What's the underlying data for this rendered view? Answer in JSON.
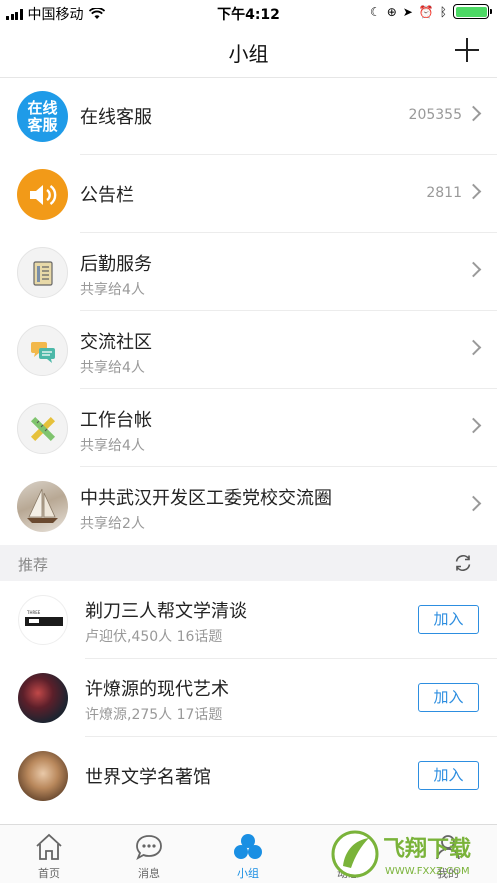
{
  "status": {
    "carrier": "中国移动",
    "time": "下午4:12",
    "battery_level": 1.0
  },
  "nav": {
    "title": "小组"
  },
  "groups": [
    {
      "title": "在线客服",
      "count": "205355",
      "avatar_text": "在线\n客服",
      "icon": "customer-service-icon"
    },
    {
      "title": "公告栏",
      "count": "2811",
      "icon": "speaker-icon"
    },
    {
      "title": "后勤服务",
      "sub": "共享给4人",
      "icon": "document-icon"
    },
    {
      "title": "交流社区",
      "sub": "共享给4人",
      "icon": "chat-bubbles-icon"
    },
    {
      "title": "工作台帐",
      "sub": "共享给4人",
      "icon": "ruler-pencil-icon"
    },
    {
      "title": "中共武汉开发区工委党校交流圈",
      "sub": "共享给2人",
      "icon": "sailboat-photo"
    }
  ],
  "section": {
    "label": "推荐"
  },
  "recommend": [
    {
      "title": "剃刀三人帮文学清谈",
      "sub": "卢迎伏,450人 16话题",
      "join": "加入"
    },
    {
      "title": "许燎源的现代艺术",
      "sub": "许燎源,275人 17话题",
      "join": "加入"
    },
    {
      "title": "世界文学名著馆",
      "join": "加入"
    }
  ],
  "tabs": [
    {
      "label": "首页",
      "icon": "home-icon"
    },
    {
      "label": "消息",
      "icon": "message-icon"
    },
    {
      "label": "小组",
      "icon": "group-icon",
      "active": true
    },
    {
      "label": "动态",
      "icon": "activity-icon"
    },
    {
      "label": "我的",
      "icon": "profile-icon"
    }
  ],
  "watermark": {
    "text": "飞翔下载",
    "url_text": "WWW.FXXZ.COM"
  },
  "colors": {
    "accent": "#1a8fe3",
    "join": "#2d8ee0",
    "orange": "#f29a18",
    "battery": "#4cd964"
  }
}
